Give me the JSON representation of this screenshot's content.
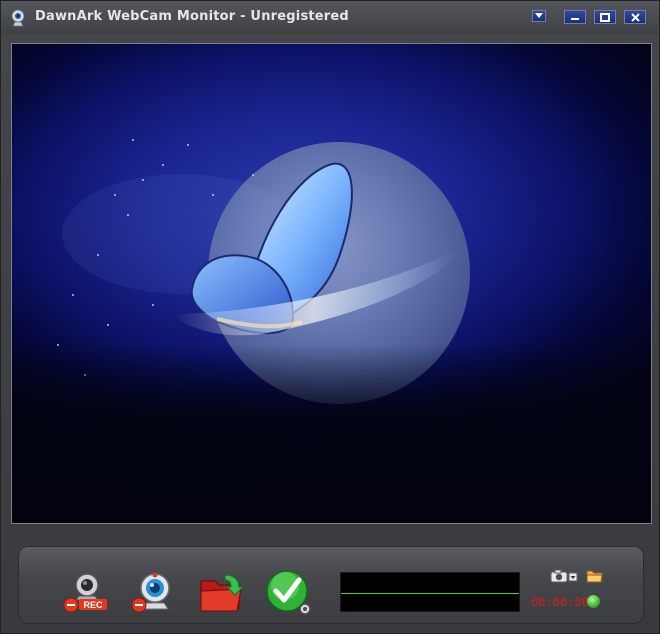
{
  "window": {
    "title": "DawnArk WebCam Monitor - Unregistered",
    "controls": [
      "menu-dropdown",
      "minimize",
      "maximize",
      "close"
    ]
  },
  "toolbar": {
    "record_label": "REC",
    "items": [
      "record-webcam",
      "webcam-settings",
      "open-folder",
      "confirm-settings"
    ]
  },
  "status": {
    "timer": "00:00:00"
  },
  "colors": {
    "timer": "#d41e1e",
    "meter_line": "#38d157",
    "window_bg": "#3b3d41",
    "title_button": "#1d2f73"
  }
}
